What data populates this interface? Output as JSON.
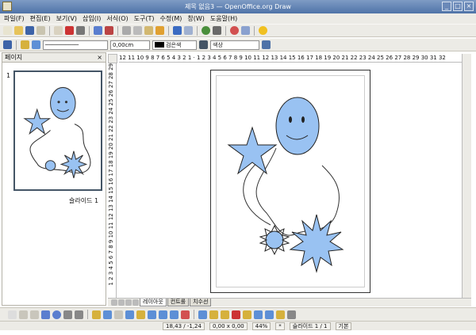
{
  "window": {
    "title": "제목 없음3 — OpenOffice.org Draw",
    "minimize": "_",
    "maximize": "□",
    "close": "×"
  },
  "menubar": {
    "items": [
      "파일(F)",
      "편집(E)",
      "보기(V)",
      "삽입(I)",
      "서식(O)",
      "도구(T)",
      "수정(M)",
      "창(W)",
      "도움말(H)"
    ]
  },
  "line_toolbar": {
    "line_width": "0,00cm",
    "color_name": "검은색",
    "area_style": "색상"
  },
  "pages_panel": {
    "title": "페이지",
    "close": "×",
    "slide_number": "1",
    "slide_label": "슬라이드 1"
  },
  "ruler": {
    "horizontal": "12 11 10 9 8 7 6 5 4 3 2 1 · 1 2 3 4 5 6 7 8 9 10 11 12 13 14 15 16 17 18 19 20 21 22 23 24 25 26 27 28 29 30 31 32",
    "vertical": "1 2 3 4 5 6 7 8 9 10 11 12 13 14 15 16 17 18 19 20 21 22 23 24 25 26 27 28 29"
  },
  "tabs": [
    "레이아웃",
    "컨트롤",
    "치수선"
  ],
  "statusbar": {
    "position": "18,43 / -1,24",
    "size": "0,00 x 0,00",
    "zoom": "44%",
    "modified": "*",
    "page": "슬라이드 1 / 1",
    "layout": "기본"
  },
  "colors": {
    "shape_fill": "#99c2f2",
    "titlebar": "#5b7bb0"
  }
}
